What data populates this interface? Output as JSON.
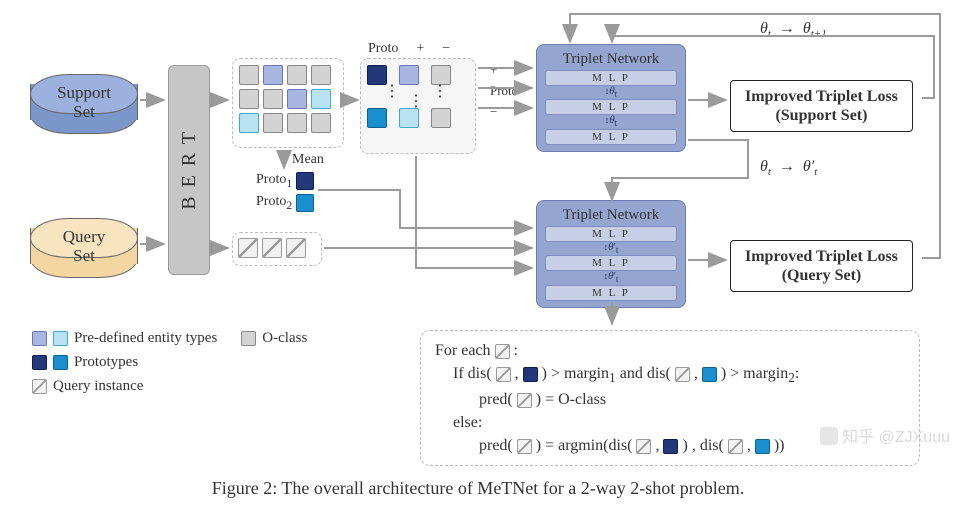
{
  "inputs": {
    "support_label_1": "Support",
    "support_label_2": "Set",
    "query_label_1": "Query",
    "query_label_2": "Set"
  },
  "encoder": {
    "name": "B E R T"
  },
  "grid": {
    "mean_label": "Mean"
  },
  "triplet_header": {
    "proto": "Proto",
    "plus": "+",
    "minus": "−",
    "proto_side": "Proto",
    "plus_side": "+",
    "minus_side": "−"
  },
  "protos": {
    "p1": "Proto",
    "p1_sub": "1",
    "p2": "Proto",
    "p2_sub": "2"
  },
  "networks": {
    "support": {
      "title": "Triplet Network",
      "mlp": "M  L  P",
      "theta": "θ",
      "theta_sub": "t"
    },
    "query": {
      "title": "Triplet Network",
      "mlp": "M  L  P",
      "theta_prime_pre": "θ",
      "theta_prime_sub": "t",
      "theta_prime_mark": "′"
    }
  },
  "loss": {
    "support_1": "Improved Triplet Loss",
    "support_2": "(Support Set)",
    "query_1": "Improved Triplet Loss",
    "query_2": "(Query Set)"
  },
  "formulas": {
    "top_left": "θ",
    "top_left_sub": "t",
    "top_arrow": "→",
    "top_right": "θ",
    "top_right_sub": "t+1",
    "mid_left": "θ",
    "mid_left_sub": "t",
    "mid_arrow": "→",
    "mid_right": "θ",
    "mid_right_sub": "t",
    "mid_right_mark": "′"
  },
  "legend": {
    "pre": "Pre-defined entity types",
    "oclass": "O-class",
    "proto": "Prototypes",
    "query": "Query instance"
  },
  "pseudo": {
    "line1_a": "For each ",
    "line1_b": " :",
    "line2_a": "If dis( ",
    "line2_b": " , ",
    "line2_c": " ) > margin",
    "line2_sub1": "1",
    "line2_d": " and dis( ",
    "line2_e": " , ",
    "line2_f": " ) > margin",
    "line2_sub2": "2",
    "line2_g": ":",
    "line3_a": "pred( ",
    "line3_b": " ) = O-class",
    "line4": "else:",
    "line5_a": "pred( ",
    "line5_b": " ) = argmin(dis( ",
    "line5_c": " , ",
    "line5_d": " ) , dis( ",
    "line5_e": " , ",
    "line5_f": " ))"
  },
  "caption": "Figure 2: The overall architecture of MeTNet for a 2-way 2-shot problem.",
  "watermark": "知乎 @ZJXuuu",
  "chart_data": {
    "type": "diagram",
    "description": "Architecture of MeTNet for a 2-way 2-shot few-shot NER problem.",
    "components": [
      {
        "name": "Support Set",
        "role": "input",
        "shape": "cylinder",
        "color": "blue"
      },
      {
        "name": "Query Set",
        "role": "input",
        "shape": "cylinder",
        "color": "orange"
      },
      {
        "name": "BERT",
        "role": "encoder",
        "shape": "vertical-box"
      },
      {
        "name": "Token embeddings (support)",
        "role": "feature-grid",
        "notes": "Mean pooled into prototypes Proto1, Proto2"
      },
      {
        "name": "Triplet samples",
        "role": "triplets",
        "columns": [
          "Proto",
          "+",
          "-"
        ]
      },
      {
        "name": "Triplet Network (support)",
        "role": "MLP triplet",
        "params": "theta_t",
        "outputs": "Improved Triplet Loss (Support Set)",
        "update": "theta_t -> theta_t+1"
      },
      {
        "name": "Triplet Network (query)",
        "role": "MLP triplet",
        "params": "theta_t'",
        "outputs": "Improved Triplet Loss (Query Set)",
        "adapted_from": "theta_t -> theta_t'"
      },
      {
        "name": "Prediction rule",
        "role": "inference",
        "rule": "For each query token q: if dis(q,Proto1)>margin1 and dis(q,Proto2)>margin2 then pred(q)=O-class else pred(q)=argmin(dis(q,Proto1),dis(q,Proto2))"
      }
    ],
    "legend": {
      "pre_defined_entity_types": [
        "light-purple",
        "light-cyan"
      ],
      "o_class": "grey",
      "prototypes": [
        "dark-navy",
        "teal"
      ],
      "query_instance": "hatched-grey"
    }
  }
}
